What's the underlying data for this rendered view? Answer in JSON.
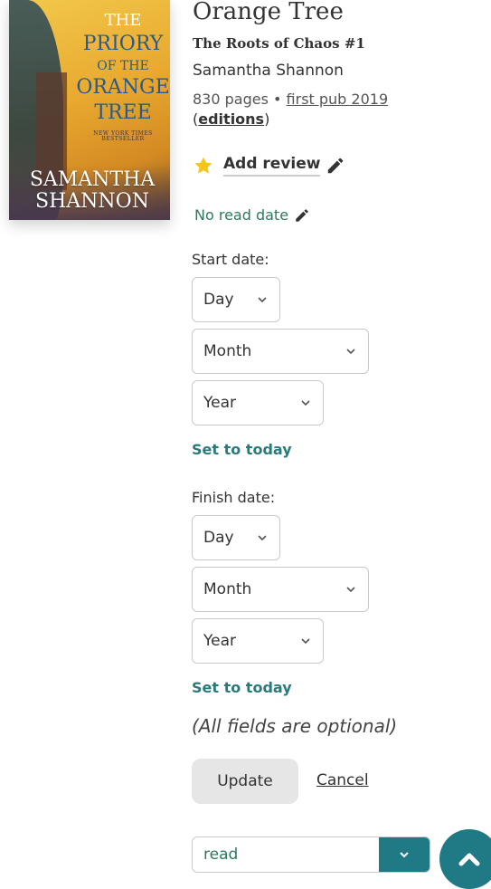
{
  "cover": {
    "line1": "THE",
    "line2": "PRIORY",
    "line3": "OF THE",
    "line4": "ORANGE",
    "line5": "TREE",
    "tagline": "NEW YORK TIMES BESTSELLER",
    "author_line1": "SAMANTHA",
    "author_line2": "SHANNON"
  },
  "book": {
    "title": "Orange Tree",
    "series": "The Roots of Chaos #1",
    "author": "Samantha Shannon",
    "pages_text": "830 pages • ",
    "first_pub": "first pub 2019",
    "editions_open": "(",
    "editions_label": "editions",
    "editions_close": ")"
  },
  "review": {
    "label": "Add review"
  },
  "read_date": {
    "label": "No read date"
  },
  "start": {
    "label": "Start date:",
    "day": "Day",
    "month": "Month",
    "year": "Year",
    "set_today": "Set to today"
  },
  "finish": {
    "label": "Finish date:",
    "day": "Day",
    "month": "Month",
    "year": "Year",
    "set_today": "Set to today"
  },
  "optional_note": "(All fields are optional)",
  "actions": {
    "update": "Update",
    "cancel": "Cancel"
  },
  "shelf": {
    "value": "read"
  },
  "colors": {
    "teal": "#1f7a85",
    "green_link": "#2b7a5f",
    "star": "#f5c518"
  },
  "icons": {
    "star": "star-icon",
    "pencil": "pencil-icon",
    "chevron": "chevron-down-icon",
    "scroll_top": "chevron-up-icon"
  }
}
